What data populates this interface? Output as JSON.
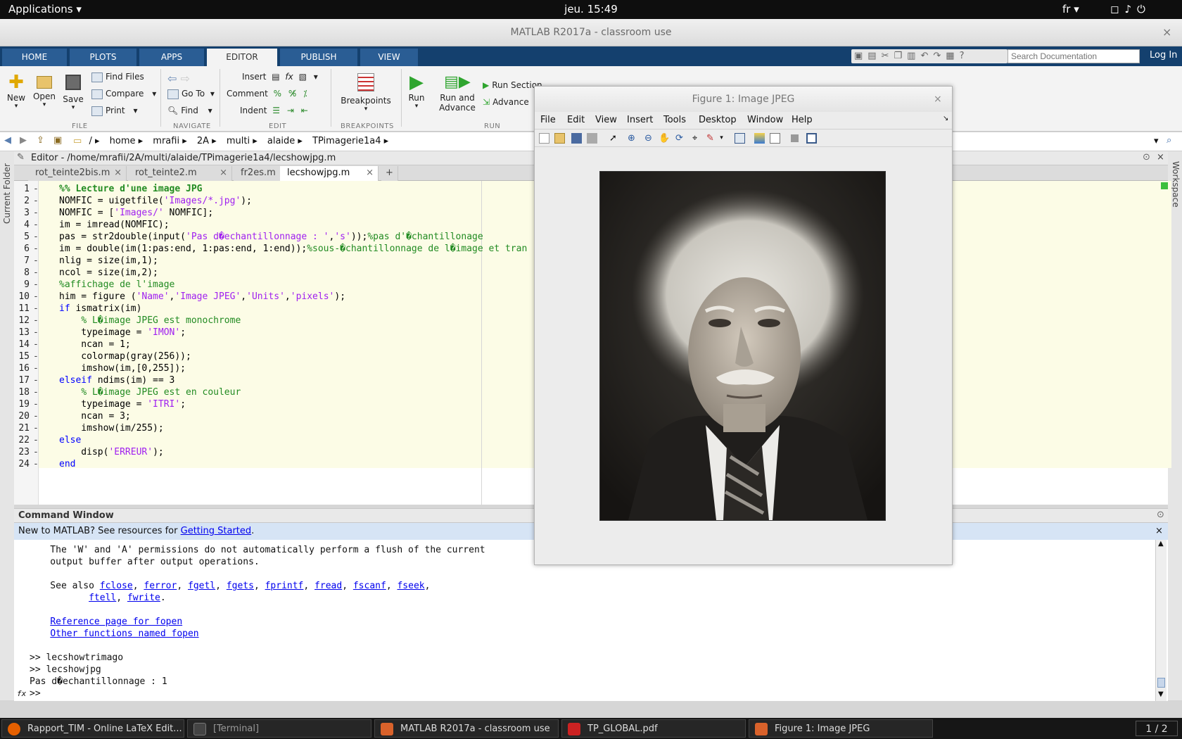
{
  "topbar": {
    "applications": "Applications",
    "clock": "jeu. 15:49",
    "lang": "fr",
    "tray_icons": [
      "window-icon",
      "volume-icon",
      "power-icon"
    ]
  },
  "window": {
    "title": "MATLAB R2017a - classroom use"
  },
  "ribbon_tabs": [
    "HOME",
    "PLOTS",
    "APPS",
    "EDITOR",
    "PUBLISH",
    "VIEW"
  ],
  "search_placeholder": "Search Documentation",
  "login": "Log In",
  "ribbon": {
    "file": {
      "label": "FILE",
      "new": "New",
      "open": "Open",
      "save": "Save",
      "find_files": "Find Files",
      "compare": "Compare",
      "print": "Print"
    },
    "navigate": {
      "label": "NAVIGATE",
      "goto": "Go To",
      "find": "Find"
    },
    "edit": {
      "label": "EDIT",
      "insert": "Insert",
      "comment": "Comment",
      "indent": "Indent"
    },
    "breakpoints": {
      "label": "BREAKPOINTS",
      "breakpoints": "Breakpoints"
    },
    "run": {
      "label": "RUN",
      "run": "Run",
      "run_and_advance": "Run and Advance",
      "run_section": "Run Section",
      "advance": "Advance"
    }
  },
  "address": {
    "root": "/",
    "crumbs": [
      "home",
      "mrafii",
      "2A",
      "multi",
      "alaide",
      "TPimagerie1a4"
    ]
  },
  "side_panels": {
    "current_folder": "Current Folder",
    "workspace": "Workspace"
  },
  "editor": {
    "title": "Editor - /home/mrafii/2A/multi/alaide/TPimagerie1a4/lecshowjpg.m",
    "tabs": [
      "rot_teinte2bis.m",
      "rot_teinte2.m",
      "fr2es.m",
      "lecshowjpg.m"
    ],
    "active_tab": "lecshowjpg.m",
    "lines": [
      [
        {
          "t": "%% Lecture d'une image JPG",
          "c": "sec"
        }
      ],
      [
        {
          "t": "NOMFIC = uigetfile(",
          "c": ""
        },
        {
          "t": "'Images/*.jpg'",
          "c": "s"
        },
        {
          "t": ");",
          "c": ""
        }
      ],
      [
        {
          "t": "NOMFIC = [",
          "c": ""
        },
        {
          "t": "'Images/'",
          "c": "s"
        },
        {
          "t": " NOMFIC];",
          "c": ""
        }
      ],
      [
        {
          "t": "im = imread(NOMFIC);",
          "c": ""
        }
      ],
      [
        {
          "t": "pas = str2double(input(",
          "c": ""
        },
        {
          "t": "'Pas d�echantillonnage : '",
          "c": "s"
        },
        {
          "t": ",",
          "c": ""
        },
        {
          "t": "'s'",
          "c": "s"
        },
        {
          "t": "));",
          "c": ""
        },
        {
          "t": "%pas d'�chantillonage",
          "c": "cm"
        }
      ],
      [
        {
          "t": "im = double(im(1:pas:end, 1:pas:end, 1:end));",
          "c": ""
        },
        {
          "t": "%sous-�chantillonnage de l�image et tran",
          "c": "cm"
        }
      ],
      [
        {
          "t": "nlig = size(im,1);",
          "c": ""
        }
      ],
      [
        {
          "t": "ncol = size(im,2);",
          "c": ""
        }
      ],
      [
        {
          "t": "%affichage de l'image",
          "c": "cm"
        }
      ],
      [
        {
          "t": "him = figure (",
          "c": ""
        },
        {
          "t": "'Name'",
          "c": "s"
        },
        {
          "t": ",",
          "c": ""
        },
        {
          "t": "'Image JPEG'",
          "c": "s"
        },
        {
          "t": ",",
          "c": ""
        },
        {
          "t": "'Units'",
          "c": "s"
        },
        {
          "t": ",",
          "c": ""
        },
        {
          "t": "'pixels'",
          "c": "s"
        },
        {
          "t": ");",
          "c": ""
        }
      ],
      [
        {
          "t": "if",
          "c": "k"
        },
        {
          "t": " ismatrix(im)",
          "c": ""
        }
      ],
      [
        {
          "t": "    ",
          "c": ""
        },
        {
          "t": "% L�image JPEG est monochrome",
          "c": "cm"
        }
      ],
      [
        {
          "t": "    typeimage = ",
          "c": ""
        },
        {
          "t": "'IMON'",
          "c": "s"
        },
        {
          "t": ";",
          "c": ""
        }
      ],
      [
        {
          "t": "    ncan = 1;",
          "c": ""
        }
      ],
      [
        {
          "t": "    colormap(gray(256));",
          "c": ""
        }
      ],
      [
        {
          "t": "    imshow(im,[0,255]);",
          "c": ""
        }
      ],
      [
        {
          "t": "elseif",
          "c": "k"
        },
        {
          "t": " ndims(im) == 3",
          "c": ""
        }
      ],
      [
        {
          "t": "    ",
          "c": ""
        },
        {
          "t": "% L�image JPEG est en couleur",
          "c": "cm"
        }
      ],
      [
        {
          "t": "    typeimage = ",
          "c": ""
        },
        {
          "t": "'ITRI'",
          "c": "s"
        },
        {
          "t": ";",
          "c": ""
        }
      ],
      [
        {
          "t": "    ncan = 3;",
          "c": ""
        }
      ],
      [
        {
          "t": "    imshow(im/255);",
          "c": ""
        }
      ],
      [
        {
          "t": "else",
          "c": "k"
        }
      ],
      [
        {
          "t": "    disp(",
          "c": ""
        },
        {
          "t": "'ERREUR'",
          "c": "s"
        },
        {
          "t": ");",
          "c": ""
        }
      ],
      [
        {
          "t": "end",
          "c": "k"
        }
      ]
    ]
  },
  "command_window": {
    "title": "Command Window",
    "notice_text": "New to MATLAB? See resources for ",
    "notice_link": "Getting Started",
    "notice_end": ".",
    "line1": "    The 'W' and 'A' permissions do not automatically perform a flush of the current",
    "line2": "    output buffer after output operations.",
    "see_also": "    See also ",
    "see_also_links": [
      "fclose",
      "ferror",
      "fgetl",
      "fgets",
      "fprintf",
      "fread",
      "fscanf",
      "fseek",
      "ftell",
      "fwrite"
    ],
    "ref_link": "Reference page for fopen",
    "other_link": "Other functions named fopen",
    "history": [
      ">> lecshowtrimago",
      ">> lecshowjpg",
      "Pas d�echantillonnage : 1"
    ],
    "prompt": ">>",
    "fx": "fx"
  },
  "figure": {
    "title": "Figure 1: Image JPEG",
    "menu": [
      "File",
      "Edit",
      "View",
      "Insert",
      "Tools",
      "Desktop",
      "Window",
      "Help"
    ]
  },
  "taskbar": {
    "items": [
      "Rapport_TIM - Online LaTeX Edit...",
      "[Terminal]",
      "MATLAB R2017a - classroom use",
      "TP_GLOBAL.pdf",
      "Figure 1: Image JPEG"
    ],
    "pager": "1 / 2"
  },
  "colors": {
    "ribbon_tab_bar": "#14406e",
    "editor_bg": "#fcfce6",
    "keyword": "#0000ff",
    "string": "#a020f0",
    "comment": "#228b22"
  }
}
